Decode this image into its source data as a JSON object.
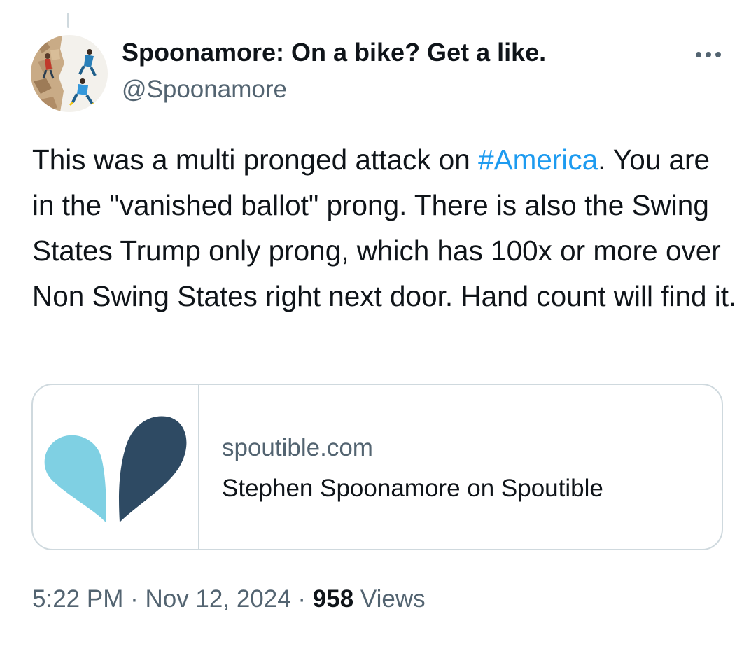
{
  "author": {
    "display_name": "Spoonamore: On a bike? Get a like.",
    "handle": "@Spoonamore"
  },
  "tweet": {
    "text_before": "This was a multi pronged attack on ",
    "hashtag": "#America",
    "text_after": ". You are in the \"vanished ballot\" prong.  There is also the Swing States Trump only prong, which has 100x or more over Non Swing States right next door. Hand count will find it."
  },
  "link_card": {
    "domain": "spoutible.com",
    "title": "Stephen Spoonamore on Spoutible",
    "logo_colors": {
      "left": "#7fd0e3",
      "right": "#2e4a63"
    }
  },
  "meta": {
    "time": "5:22 PM",
    "separator": " · ",
    "date": "Nov 12, 2024",
    "views_count": "958",
    "views_label": " Views"
  },
  "colors": {
    "text": "#0f1419",
    "secondary": "#536471",
    "link": "#1d9bf0",
    "border": "#cfd9de"
  },
  "icons": {
    "more": "more-horizontal-icon"
  }
}
